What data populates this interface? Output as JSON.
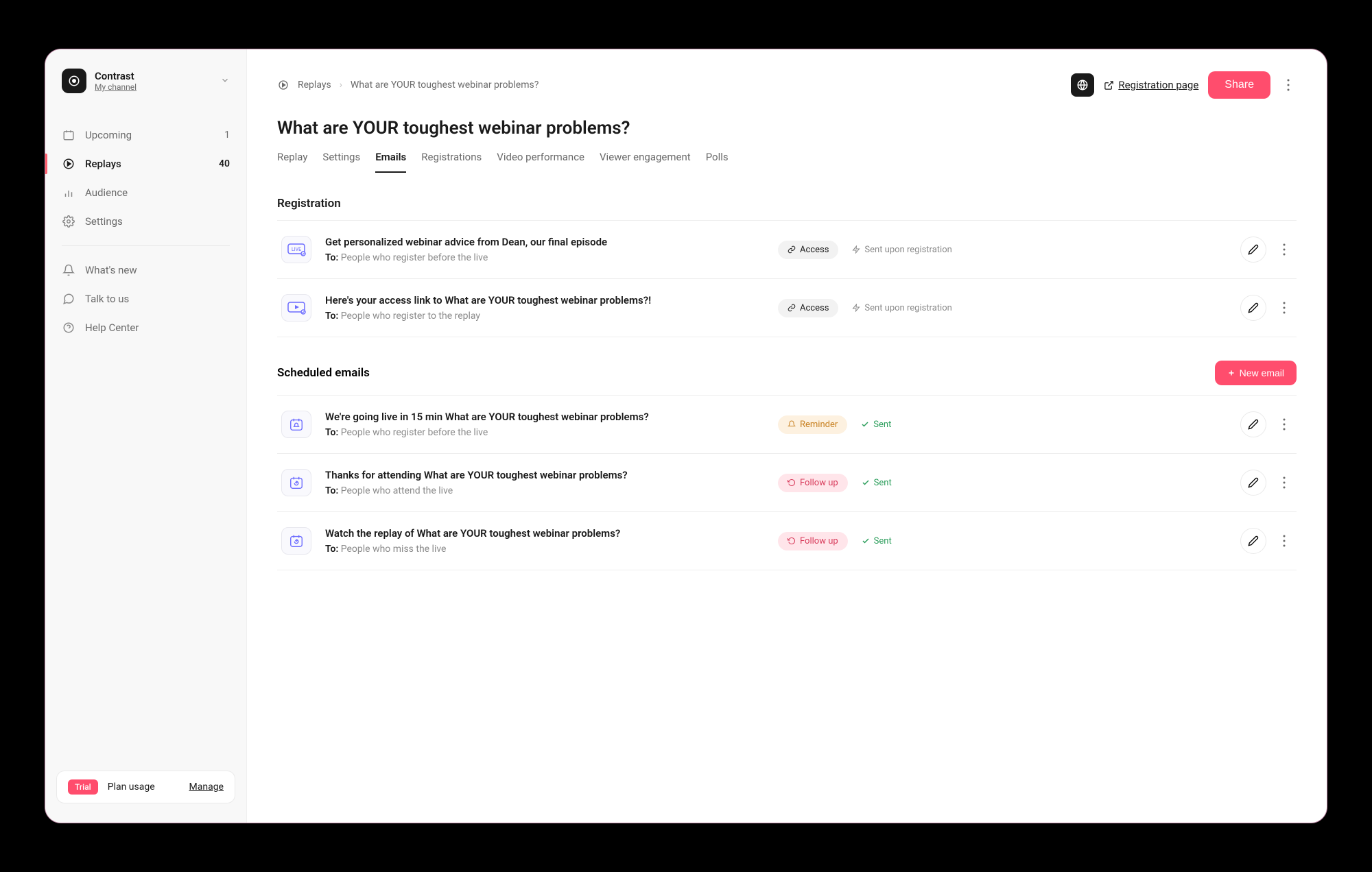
{
  "brand": {
    "name": "Contrast",
    "subtitle": "My channel"
  },
  "sidebar": {
    "items": [
      {
        "label": "Upcoming",
        "count": "1"
      },
      {
        "label": "Replays",
        "count": "40"
      },
      {
        "label": "Audience"
      },
      {
        "label": "Settings"
      }
    ],
    "secondary": [
      {
        "label": "What's new"
      },
      {
        "label": "Talk to us"
      },
      {
        "label": "Help Center"
      }
    ]
  },
  "breadcrumbs": {
    "root": "Replays",
    "current": "What are YOUR toughest webinar problems?"
  },
  "topbar": {
    "registration": "Registration page",
    "share": "Share"
  },
  "page": {
    "title": "What are YOUR toughest webinar problems?"
  },
  "tabs": [
    "Replay",
    "Settings",
    "Emails",
    "Registrations",
    "Video performance",
    "Viewer engagement",
    "Polls"
  ],
  "sections": {
    "registration": {
      "title": "Registration"
    },
    "scheduled": {
      "title": "Scheduled emails",
      "new_button": "New email"
    }
  },
  "labels": {
    "to": "To:",
    "access": "Access",
    "reminder": "Reminder",
    "followup": "Follow up",
    "sent": "Sent",
    "sent_upon_registration": "Sent upon registration"
  },
  "registration_emails": [
    {
      "title": "Get personalized webinar advice from Dean, our final episode",
      "to": "People who register before the live",
      "badge": "access",
      "status": "sent_upon_registration",
      "thumb": "live"
    },
    {
      "title": "Here's your access link to What are YOUR toughest webinar problems?!",
      "to": "People who register to the replay",
      "badge": "access",
      "status": "sent_upon_registration",
      "thumb": "play"
    }
  ],
  "scheduled_emails": [
    {
      "title": "We're going live in 15 min What are YOUR toughest webinar problems?",
      "to": "People who register before the live",
      "badge": "reminder",
      "status": "sent",
      "thumb": "bell"
    },
    {
      "title": "Thanks for attending What are YOUR toughest webinar problems?",
      "to": "People who attend the live",
      "badge": "followup",
      "status": "sent",
      "thumb": "cal"
    },
    {
      "title": "Watch the replay of What are YOUR toughest webinar problems?",
      "to": "People who miss the live",
      "badge": "followup",
      "status": "sent",
      "thumb": "cal"
    }
  ],
  "footer": {
    "trial": "Trial",
    "plan": "Plan usage",
    "manage": "Manage"
  }
}
